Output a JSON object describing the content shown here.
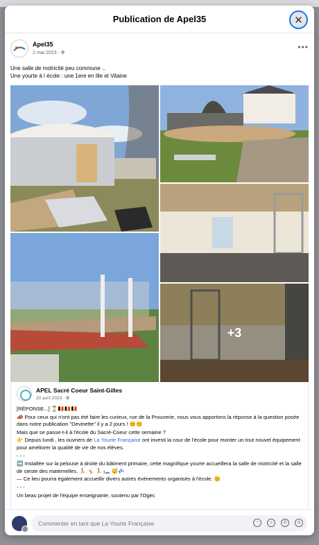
{
  "modal": {
    "title": "Publication de Apel35",
    "close_icon": "close-icon",
    "close_glyph": "✕"
  },
  "post": {
    "author": "Apel35",
    "date": "2 mai 2023",
    "privacy_icon": "globe-icon",
    "more_glyph": "•••",
    "text_line1": "Une salle de motricité peu commune ..",
    "text_line2": "Une yourte à l école : une 1ere en Ille et Vilaine",
    "more_photos": "+3"
  },
  "shared": {
    "author": "APEL Sacré Coeur Saint-Gilles",
    "date": "20 avril 2023",
    "p1": "[RÉPONSE...] ⏳🇧🇪🇧🇪🇧🇪",
    "p2": "📣 Pour ceux qui n'ont pas été faire les curieux, rue de la Prouverie, nous vous apportons la réponse à la question posée dans notre publication \"Devinette\" il y a 2 jours ! 😊😊",
    "p3": "Mais que se passe-t-il à l'école du Sacré-Coeur cette semaine ?",
    "p4_pre": "👉 Depuis lundi , les ouvriers de ",
    "p4_link": "La Yourte Française",
    "p4_post": " ont investi la cour de l'école pour monter un tout nouvel équipement pour améliorer la qualité de vie de nos élèves.",
    "sep1": "- - -",
    "p5": "➡️ Installée sur la pelouse à droite du bâtiment primaire, cette magnifique yourte accueillera la salle de motricité et la salle de sieste des maternelles. 🏃 🤸 🏃 🛏️ 😴💤",
    "p6": "— Ce lieu pourra également accueillir divers autres événements organisés à l'école. 😊",
    "sep2": "- - -",
    "p7": "Un beau projet de l'équipe enseignante, soutenu par l'Ogec"
  },
  "footer": {
    "comment_placeholder": "Commenter en tant que La Yourte Française",
    "icons": [
      "sticker-icon",
      "emoji-icon",
      "gif-icon",
      "camera-icon"
    ]
  }
}
